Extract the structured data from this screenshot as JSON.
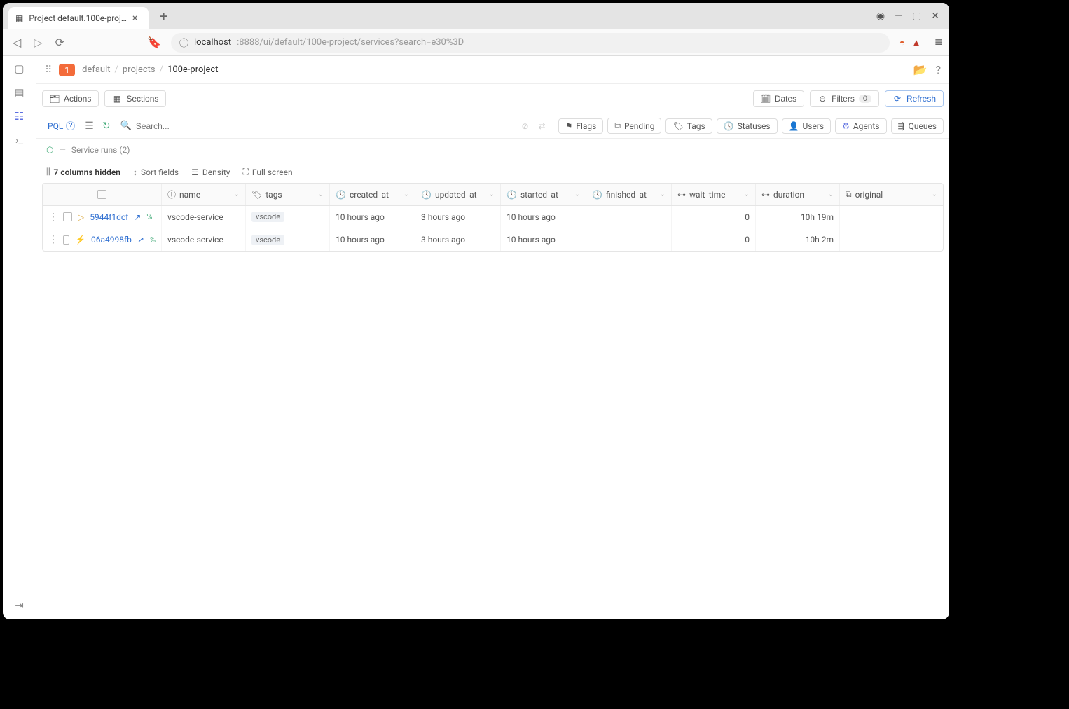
{
  "browser": {
    "tab_title": "Project default.100e-proj…",
    "url_host": "localhost",
    "url_rest": ":8888/ui/default/100e-project/services?search=e30%3D"
  },
  "topbar": {
    "badge": "1",
    "crumbs": {
      "root": "default",
      "projects": "projects",
      "current": "100e-project"
    }
  },
  "toolbar": {
    "actions": "Actions",
    "sections": "Sections",
    "dates": "Dates",
    "filters": "Filters",
    "filter_count": "0",
    "refresh": "Refresh"
  },
  "filterbar": {
    "pql": "PQL",
    "search_placeholder": "Search...",
    "flags": "Flags",
    "pending": "Pending",
    "tags": "Tags",
    "statuses": "Statuses",
    "users": "Users",
    "agents": "Agents",
    "queues": "Queues"
  },
  "svc_crumb": "Service runs (2)",
  "table_ctrls": {
    "hidden": "7 columns hidden",
    "sort": "Sort fields",
    "density": "Density",
    "fullscreen": "Full screen"
  },
  "columns": {
    "name": "name",
    "tags": "tags",
    "created_at": "created_at",
    "updated_at": "updated_at",
    "started_at": "started_at",
    "finished_at": "finished_at",
    "wait_time": "wait_time",
    "duration": "duration",
    "original": "original"
  },
  "rows": [
    {
      "status_icon": "play",
      "id": "5944f1dcf",
      "name": "vscode-service",
      "tag": "vscode",
      "created_at": "10 hours ago",
      "updated_at": "3 hours ago",
      "started_at": "10 hours ago",
      "finished_at": "",
      "wait_time": "0",
      "duration": "10h 19m"
    },
    {
      "status_icon": "bolt",
      "id": "06a4998fb",
      "name": "vscode-service",
      "tag": "vscode",
      "created_at": "10 hours ago",
      "updated_at": "3 hours ago",
      "started_at": "10 hours ago",
      "finished_at": "",
      "wait_time": "0",
      "duration": "10h 2m"
    }
  ]
}
